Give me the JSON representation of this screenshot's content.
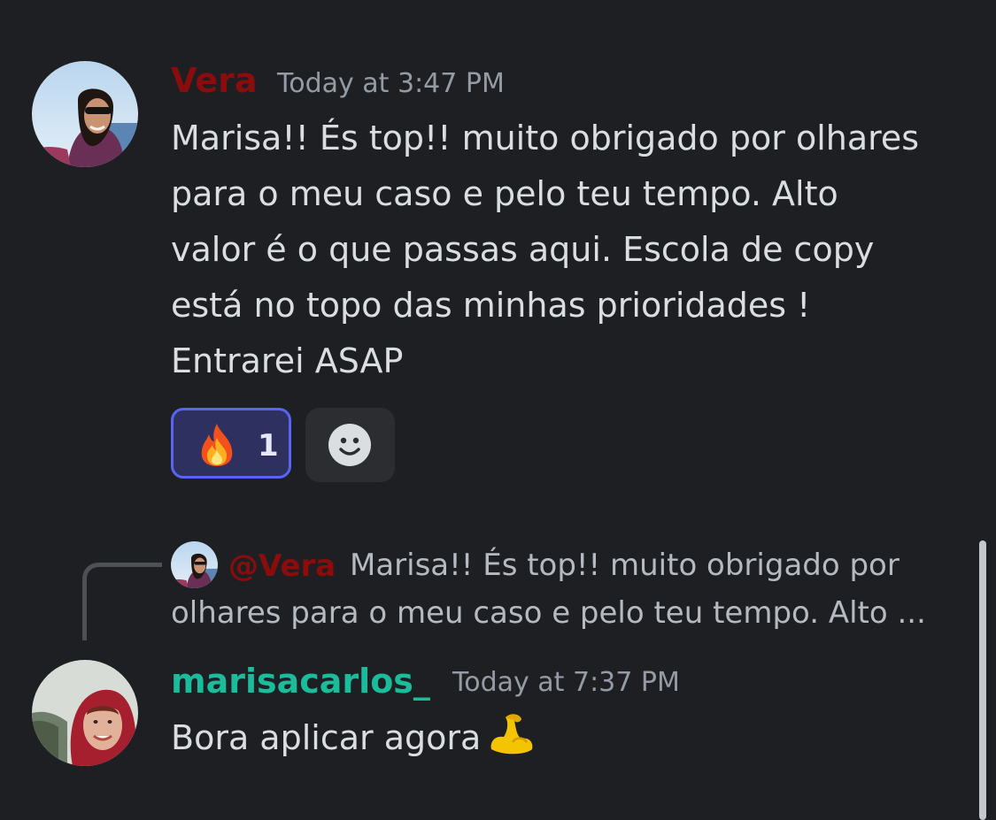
{
  "messages": [
    {
      "author": "Vera",
      "timestamp": "Today at 3:47 PM",
      "lines": [
        "Marisa!! És top!! muito obrigado por olhares",
        "para o meu caso e pelo teu tempo. Alto",
        "valor é o que passas aqui. Escola de copy",
        "está no topo das minhas prioridades !",
        "Entrarei ASAP"
      ],
      "reactions": [
        {
          "emoji": "fire-emoji",
          "count": "1",
          "active": true
        }
      ],
      "add_reaction_icon": "smile-add-reaction-icon",
      "author_color": "#8b0c0c"
    },
    {
      "author": "marisacarlos_",
      "timestamp": "Today at 7:37 PM",
      "text": "Bora aplicar agora",
      "emoji": "flexed-biceps-emoji",
      "author_color": "#1abc9c",
      "reply": {
        "mention": "@Vera",
        "line1": "Marisa!! És top!! muito obrigado por",
        "line2": "olhares para o meu caso e pelo teu tempo. Alto ..."
      }
    }
  ],
  "colors": {
    "background": "#1e1f22",
    "reaction_active_border": "#5865f2",
    "reaction_active_bg": "#2e3160",
    "muted_text": "#949ba4"
  }
}
